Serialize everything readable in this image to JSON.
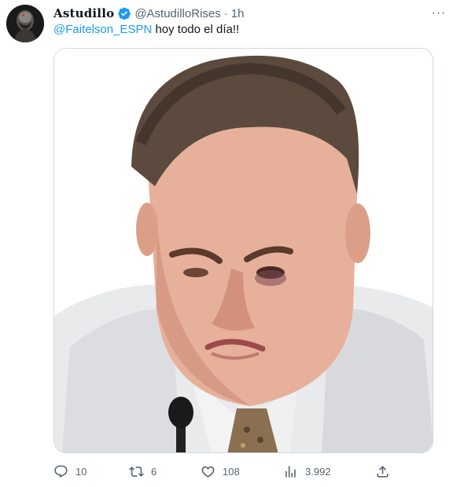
{
  "author": {
    "display_name": "Astudillo",
    "handle": "@AstudilloRises",
    "separator": "·",
    "time": "1h",
    "verified": true,
    "avatar_icon": "avatar-portrait"
  },
  "tweet": {
    "mention": "@Faitelson_ESPN",
    "text": " hoy todo el día!!"
  },
  "more_icon": "more-dots-icon",
  "more_label": "···",
  "actions": {
    "reply_count": "10",
    "retweet_count": "6",
    "like_count": "108",
    "views_count": "3.992"
  },
  "colors": {
    "accent": "#1d9bf0",
    "muted": "#536471",
    "border": "#cfd9de"
  }
}
